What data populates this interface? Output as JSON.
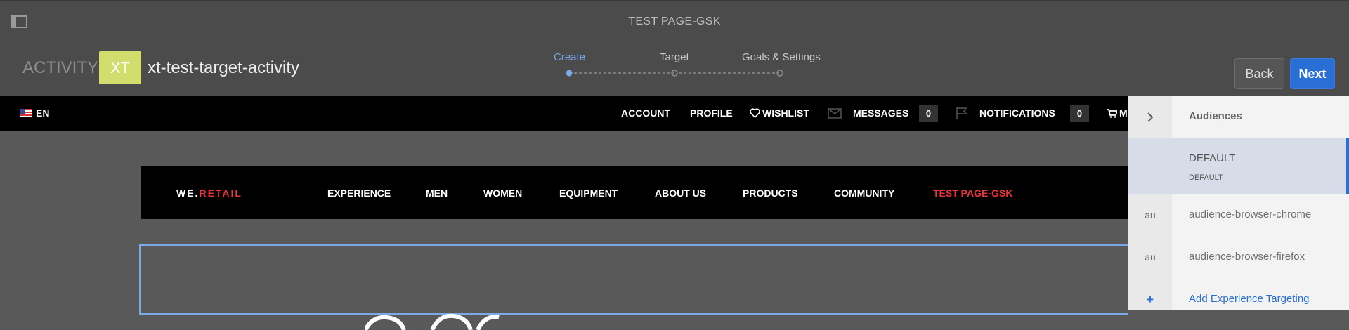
{
  "header": {
    "page_title": "TEST PAGE-GSK",
    "activity_label": "ACTIVITY:",
    "badge": "XT",
    "activity_name": "xt-test-target-activity",
    "steps": [
      "Create",
      "Target",
      "Goals & Settings"
    ],
    "back_label": "Back",
    "next_label": "Next"
  },
  "topnav": {
    "lang": "EN",
    "account": "ACCOUNT",
    "profile": "PROFILE",
    "wishlist": "WISHLIST",
    "messages": "MESSAGES",
    "messages_count": "0",
    "notifications": "NOTIFICATIONS",
    "notifications_count": "0",
    "cart_partial": "M"
  },
  "site": {
    "logo_a": "WE.",
    "logo_b": "RETAIL",
    "menu": [
      "EXPERIENCE",
      "MEN",
      "WOMEN",
      "EQUIPMENT",
      "ABOUT US",
      "PRODUCTS",
      "COMMUNITY",
      "TEST PAGE-GSK"
    ]
  },
  "panel": {
    "audiences": "Audiences",
    "default_title": "DEFAULT",
    "default_sub": "DEFAULT",
    "row1_icon": "au",
    "row1": "audience-browser-chrome",
    "row2_icon": "au",
    "row2": "audience-browser-firefox",
    "add_icon": "+",
    "add": "Add Experience Targeting"
  },
  "colors": {
    "accent": "#2a6fd5",
    "badge": "#d1de6e",
    "active_menu": "#e8343a"
  }
}
